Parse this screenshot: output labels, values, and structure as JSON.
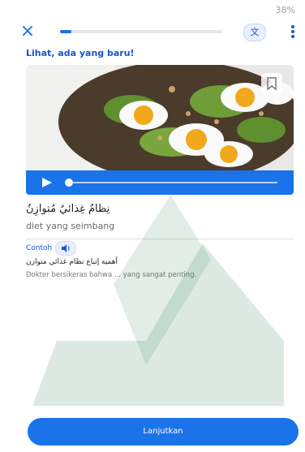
{
  "status": {
    "battery": "38%"
  },
  "lesson": {
    "progress_fraction": 0.07,
    "translate_label": "文"
  },
  "heading": "Lihat, ada yang baru!",
  "media": {
    "image_desc": "food-photo-eggs-avocado-toast"
  },
  "word": {
    "arabic": "نِظامٌ غِذائيٌ مُتوازِنٌ",
    "translation": "diet yang seimbang"
  },
  "example": {
    "label": "Contoh",
    "arabic": "أهمية إتباع نظام غذائي متوازن",
    "indonesian": "Dokter bersikeras bahwa ... yang sangat penting."
  },
  "footer": {
    "continue_label": "Lanjutkan"
  },
  "colors": {
    "accent": "#1a73e8",
    "watermark": "#2e7d4f"
  }
}
